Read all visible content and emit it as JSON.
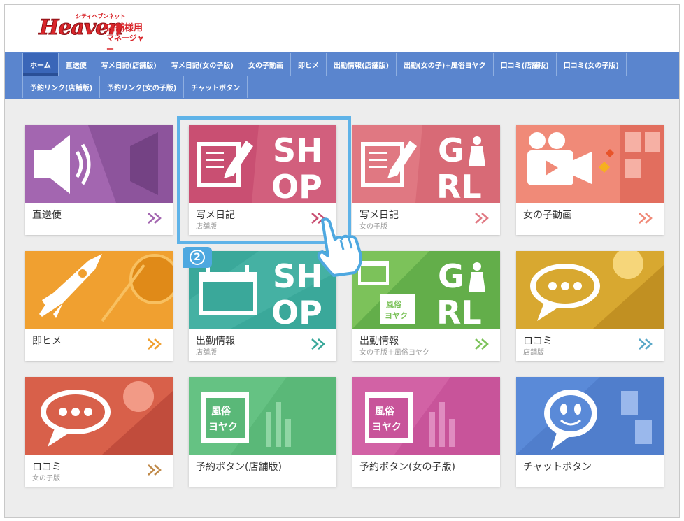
{
  "header": {
    "logo_main": "Heaven",
    "logo_small": "シティヘブンネット",
    "logo_store": "店舗様用",
    "logo_manager": "マネージャー"
  },
  "nav": {
    "row1": [
      "ホーム",
      "直送便",
      "写メ日記(店舗版)",
      "写メ日記(女の子版)",
      "女の子動画",
      "即ヒメ",
      "出勤情報(店舗版)",
      "出勤(女の子)+風俗ヨヤク",
      "口コミ(店舗版)",
      "口コミ(女の子版)"
    ],
    "row2": [
      "予約リンク(店舗版)",
      "予約リンク(女の子版)",
      "チャットボタン"
    ],
    "active": "ホーム"
  },
  "cards": [
    {
      "label": "直送便",
      "sub": "",
      "icon": "speaker-icon",
      "color": "#a366b0"
    },
    {
      "label": "写メ日記",
      "sub": "店舗版",
      "icon": "diary-shop-icon",
      "color": "#c94f72"
    },
    {
      "label": "写メ日記",
      "sub": "女の子版",
      "icon": "diary-girl-icon",
      "color": "#e07882"
    },
    {
      "label": "女の子動画",
      "sub": "",
      "icon": "video-camera-icon",
      "color": "#f08a78"
    },
    {
      "label": "即ヒメ",
      "sub": "",
      "icon": "rocket-icon",
      "color": "#f0a030"
    },
    {
      "label": "出勤情報",
      "sub": "店舗版",
      "icon": "calendar-shop-icon",
      "color": "#3aa89a"
    },
    {
      "label": "出勤情報",
      "sub": "女の子版＋風俗ヨヤク",
      "icon": "calendar-girl-icon",
      "color": "#7cc25a"
    },
    {
      "label": "ロコミ",
      "sub": "店舗版",
      "icon": "speech-bubble-icon",
      "color": "#d8a830"
    },
    {
      "label": "ロコミ",
      "sub": "女の子版",
      "icon": "speech-bubble-icon",
      "color": "#d8604a"
    },
    {
      "label": "予約ボタン(店舗版)",
      "sub": "",
      "icon": "reservation-calendar-icon",
      "color": "#5ab878"
    },
    {
      "label": "予約ボタン(女の子版)",
      "sub": "",
      "icon": "reservation-calendar-icon",
      "color": "#c8549a"
    },
    {
      "label": "チャットボタン",
      "sub": "",
      "icon": "chat-face-icon",
      "color": "#5a8ad8"
    }
  ],
  "arrow_colors": [
    "#a366b0",
    "#c94f72",
    "#e07882",
    "#f08a78",
    "#f0a030",
    "#3aa89a",
    "#7cc25a",
    "#5aa8c8",
    "#c08a4a",
    "#5ab878",
    "#c8549a",
    "#5a8ad8"
  ],
  "step_badge": "②",
  "shop_text": "SHOP",
  "girl_text": "GIRL",
  "reserve_line1": "風俗",
  "reserve_line2": "ヨヤク"
}
